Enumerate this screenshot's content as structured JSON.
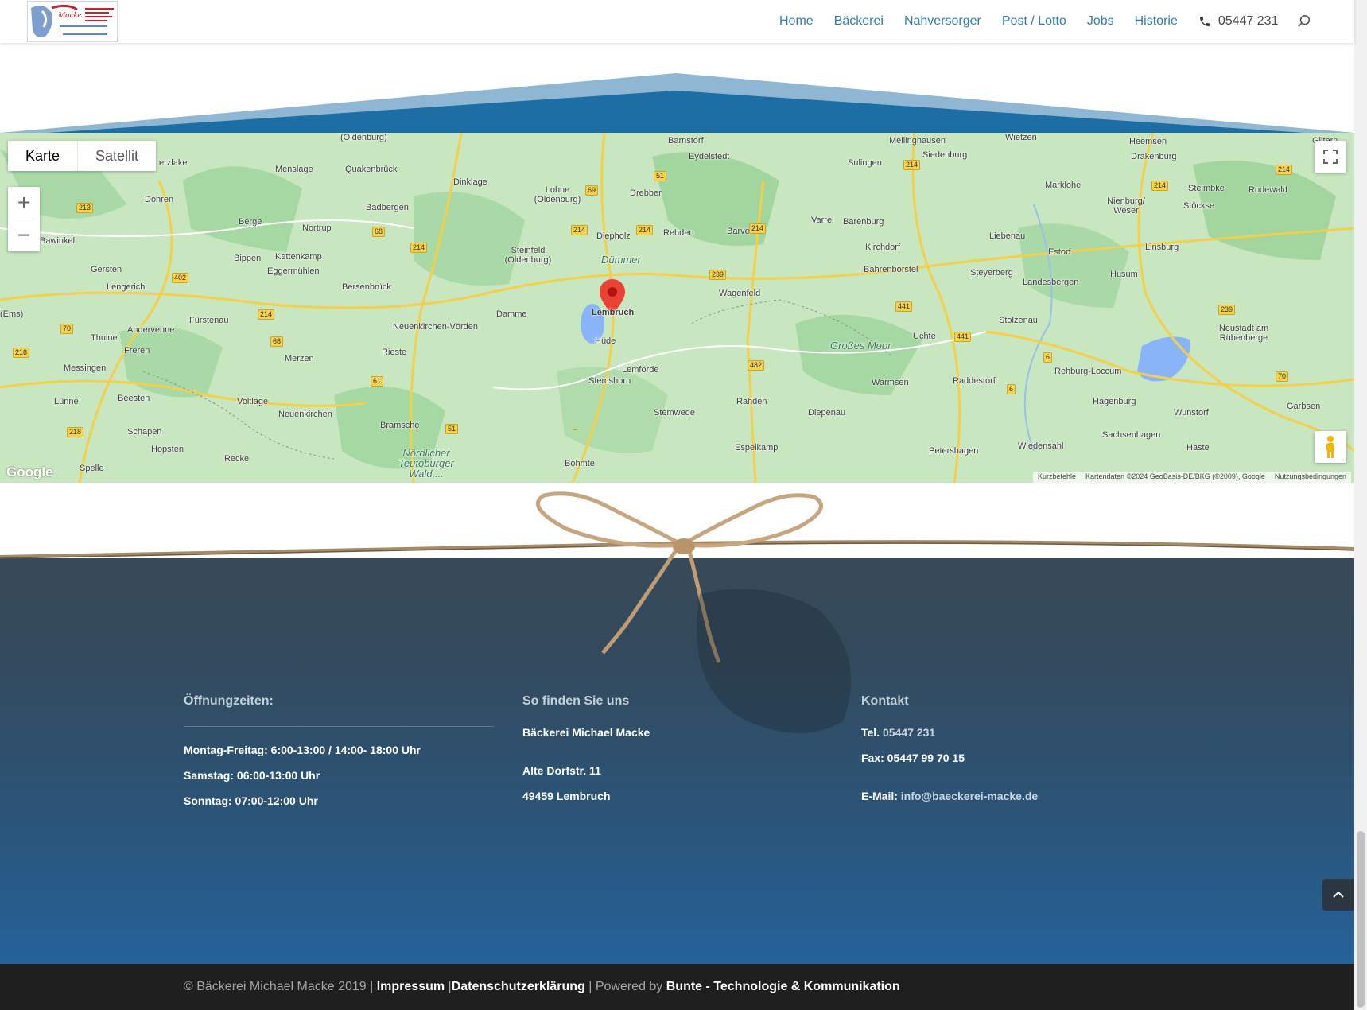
{
  "header": {
    "nav": [
      "Home",
      "Bäckerei",
      "Nahversorger",
      "Post / Lotto",
      "Jobs",
      "Historie"
    ],
    "phone": "05447 231"
  },
  "map": {
    "type_buttons": {
      "map": "Karte",
      "satellite": "Satellit"
    },
    "zoom_in": "+",
    "zoom_out": "−",
    "google": "Google",
    "attribution": [
      "Kurzbefehle",
      "Kartendaten ©2024 GeoBasis-DE/BKG (©2009), Google",
      "Nutzungsbedingungen"
    ],
    "marker_place": "Lembruch",
    "places": [
      "(Oldenburg)",
      "Barnstorf",
      "Eydelstedt",
      "Mellinghausen",
      "Siedenburg",
      "Wietzen",
      "Heemsen",
      "Drakenburg",
      "Giltern",
      "erzlake",
      "Menslage",
      "Quakenbrück",
      "Dinklage",
      "Lohne (Oldenburg)",
      "Drebber",
      "Sulingen",
      "Marklohe",
      "Nienburg/ Weser",
      "Steimbke",
      "Rodewald",
      "Stöckse",
      "Dohren",
      "Badbergen",
      "Berge",
      "Nortrup",
      "Diepholz",
      "Rehden",
      "Barver",
      "Varrel",
      "Barenburg",
      "Liebenau",
      "Bawinkel",
      "Bippen",
      "Kettenkamp",
      "Eggermühlen",
      "Steinfeld (Oldenburg)",
      "Dümmer",
      "Kirchdorf",
      "Estorf",
      "Linsburg",
      "Gersten",
      "Lengerich",
      "Bersenbrück",
      "Bahrenborstel",
      "Steyerberg",
      "Landesbergen",
      "Husum",
      "Damme",
      "Wagenfeld",
      "(Ems)",
      "Fürstenau",
      "Andervenne",
      "Neuenkirchen-Vörden",
      "Hüde",
      "Großes Moor",
      "Uchte",
      "Stolzenau",
      "Neustadt am Rübenberge",
      "Thuine",
      "Freren",
      "Rieste",
      "Merzen",
      "Lemförde",
      "Stemshorn",
      "Raddestorf",
      "Rehburg-Loccum",
      "Messingen",
      "Warmsen",
      "Lünne",
      "Beesten",
      "Voltlage",
      "Neuenkirchen",
      "Rahden",
      "Diepenau",
      "Hagenburg",
      "Wunstorf",
      "Garbsen",
      "Stemwede",
      "Schapen",
      "Bramsche",
      "Sachsenhagen",
      "Hopsten",
      "Recke",
      "Spelle",
      "Nördlicher Teutoburger Wald,...",
      "Bohmte",
      "Espelkamp",
      "Petershagen",
      "Wiedensahl",
      "Haste"
    ],
    "roads": [
      "213",
      "214",
      "402",
      "68",
      "214",
      "69",
      "51",
      "214",
      "214",
      "239",
      "214",
      "214",
      "214",
      "214",
      "70",
      "218",
      "68",
      "61",
      "441",
      "441",
      "6",
      "239",
      "482",
      "6",
      "70",
      "218",
      "51"
    ]
  },
  "footer": {
    "hours": {
      "title": "Öffnungzeiten:",
      "lines": [
        "Montag-Freitag: 6:00-13:00 / 14:00- 18:00 Uhr",
        "Samstag: 06:00-13:00 Uhr",
        "Sonntag: 07:00-12:00 Uhr"
      ]
    },
    "location": {
      "title": "So finden Sie uns",
      "name": "Bäckerei Michael Macke",
      "street": "Alte Dorfstr. 11",
      "city": "49459 Lembruch"
    },
    "contact": {
      "title": "Kontakt",
      "tel_label": "Tel.",
      "tel": "05447 231",
      "fax": "Fax: 05447 99 70 15",
      "email_label": "E-Mail:",
      "email": "info@baeckerei-macke.de"
    }
  },
  "bottom": {
    "copyright": "© Bäckerei Michael Macke 2019 |",
    "impressum": "Impressum",
    "sep": " |",
    "datenschutz": "Datenschutzerklärung",
    "powered": " | Powered by ",
    "agency": "Bunte - Technologie & Kommunikation"
  },
  "colors": {
    "accent": "#2f7db3",
    "footer": "#2b5479",
    "bottom_bar": "#1f1f1f"
  }
}
